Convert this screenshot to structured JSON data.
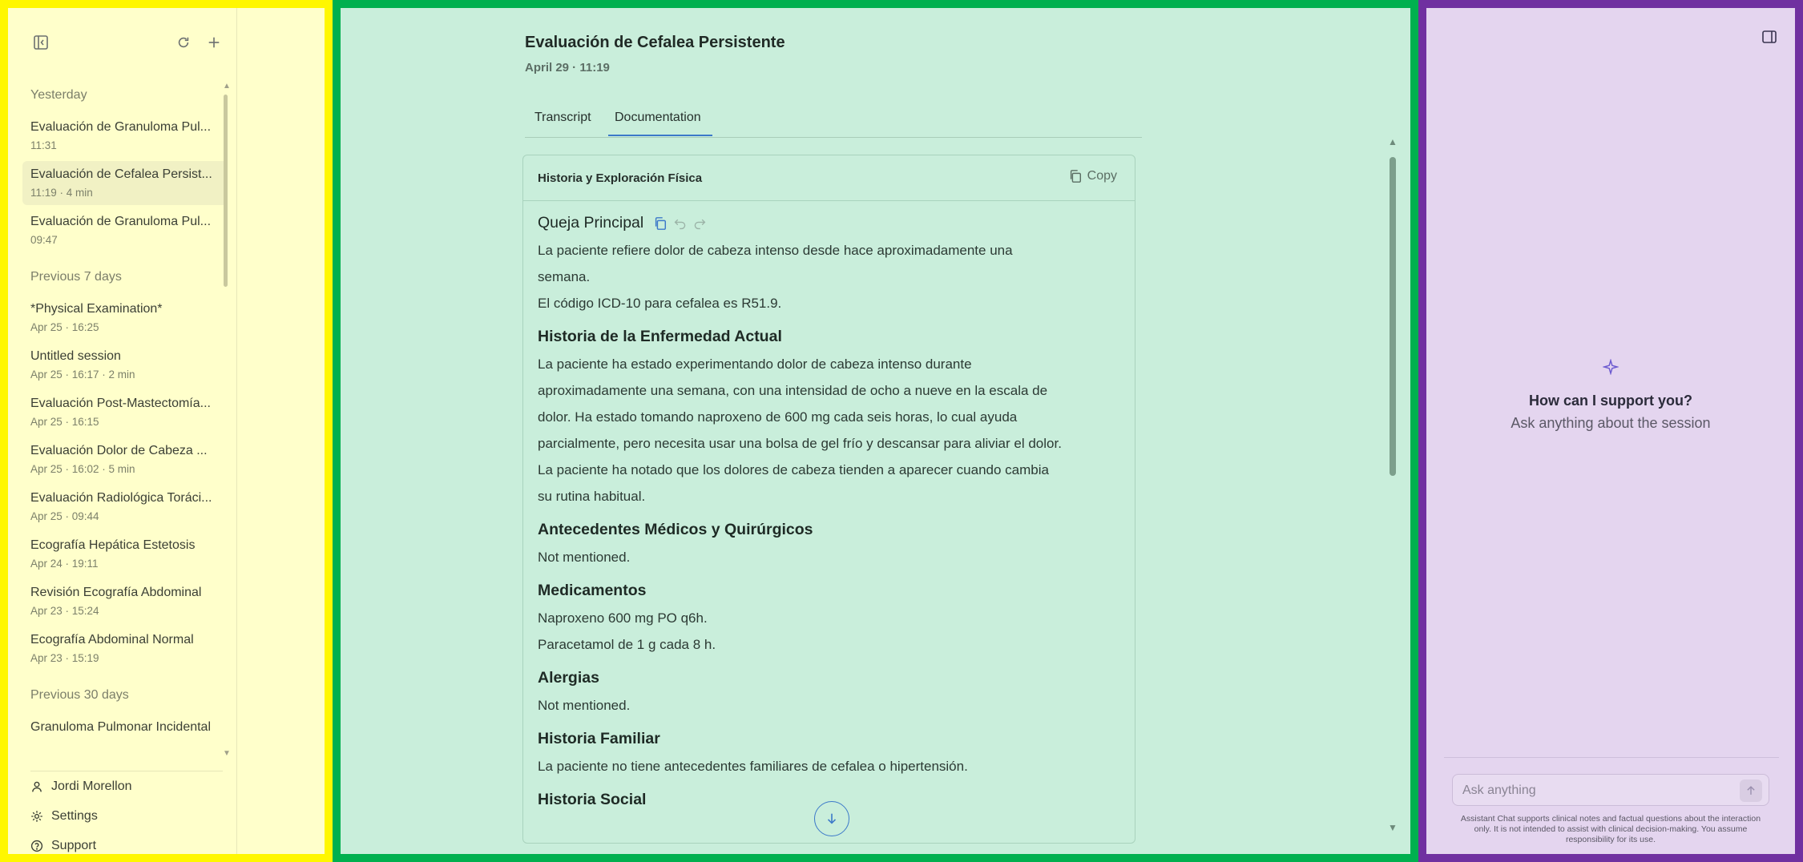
{
  "sidebar": {
    "groups": [
      {
        "label": "Yesterday",
        "items": [
          {
            "title": "Evaluación de Granuloma Pul...",
            "meta": "11:31"
          },
          {
            "title": "Evaluación de Cefalea Persist...",
            "meta": "11:19 · 4 min"
          },
          {
            "title": "Evaluación de Granuloma Pul...",
            "meta": "09:47"
          }
        ]
      },
      {
        "label": "Previous 7 days",
        "items": [
          {
            "title": "*Physical Examination*",
            "meta": "Apr 25 · 16:25"
          },
          {
            "title": "Untitled session",
            "meta": "Apr 25 · 16:17 · 2 min"
          },
          {
            "title": "Evaluación Post-Mastectomía...",
            "meta": "Apr 25 · 16:15"
          },
          {
            "title": "Evaluación Dolor de Cabeza ...",
            "meta": "Apr 25 · 16:02 · 5 min"
          },
          {
            "title": "Evaluación Radiológica Toráci...",
            "meta": "Apr 25 · 09:44"
          },
          {
            "title": "Ecografía Hepática Estetosis",
            "meta": "Apr 24 · 19:11"
          },
          {
            "title": "Revisión Ecografía Abdominal",
            "meta": "Apr 23 · 15:24"
          },
          {
            "title": "Ecografía Abdominal Normal",
            "meta": "Apr 23 · 15:19"
          }
        ]
      },
      {
        "label": "Previous 30 days",
        "items": [
          {
            "title": "Granuloma Pulmonar Incidental",
            "meta": ""
          }
        ]
      }
    ],
    "user_name": "Jordi Morellon",
    "settings_label": "Settings",
    "support_label": "Support"
  },
  "document": {
    "title": "Evaluación de Cefalea Persistente",
    "date": "April 29 · 11:19",
    "tabs": [
      "Transcript",
      "Documentation"
    ],
    "card_title": "Historia y Exploración Física",
    "copy_label": "Copy",
    "sections": [
      {
        "heading": "Queja Principal",
        "lines": [
          "La paciente refiere dolor de cabeza intenso desde hace aproximadamente una semana.",
          "El código ICD-10 para cefalea es R51.9."
        ]
      },
      {
        "heading": "Historia de la Enfermedad Actual",
        "lines": [
          "La paciente ha estado experimentando dolor de cabeza intenso durante aproximadamente una semana, con una intensidad de ocho a nueve en la escala de dolor. Ha estado tomando naproxeno de 600 mg cada seis horas, lo cual ayuda parcialmente, pero necesita usar una bolsa de gel frío y descansar para aliviar el dolor. La paciente ha notado que los dolores de cabeza tienden a aparecer cuando cambia su rutina habitual."
        ]
      },
      {
        "heading": "Antecedentes Médicos y Quirúrgicos",
        "lines": [
          "Not mentioned."
        ]
      },
      {
        "heading": "Medicamentos",
        "lines": [
          "Naproxeno 600 mg PO q6h.",
          "Paracetamol de 1 g cada 8 h."
        ]
      },
      {
        "heading": "Alergias",
        "lines": [
          "Not mentioned."
        ]
      },
      {
        "heading": "Historia Familiar",
        "lines": [
          "La paciente no tiene antecedentes familiares de cefalea o hipertensión."
        ]
      },
      {
        "heading": "Historia Social",
        "lines": [
          ""
        ]
      }
    ]
  },
  "assistant": {
    "title": "How can I support you?",
    "subtitle": "Ask anything about the session",
    "input_placeholder": "Ask anything",
    "disclaimer": "Assistant Chat supports clinical notes and factual questions about the interaction only. It is not intended to assist with clinical decision-making. You assume responsibility for its use."
  },
  "colors": {
    "left_bg": "#ffffcb",
    "left_border": "#fff700",
    "center_bg": "#c9eedb",
    "center_border": "#00b04f",
    "right_bg": "#e4d5ef",
    "right_border": "#7030a0",
    "accent": "#3c79c9"
  },
  "icons": [
    "sidebar-toggle-icon",
    "refresh-icon",
    "plus-icon",
    "user-icon",
    "gear-icon",
    "help-icon",
    "copy-icon",
    "undo-icon",
    "redo-icon",
    "arrow-down-icon",
    "sparkle-icon",
    "panel-right-icon",
    "send-arrow-icon"
  ]
}
